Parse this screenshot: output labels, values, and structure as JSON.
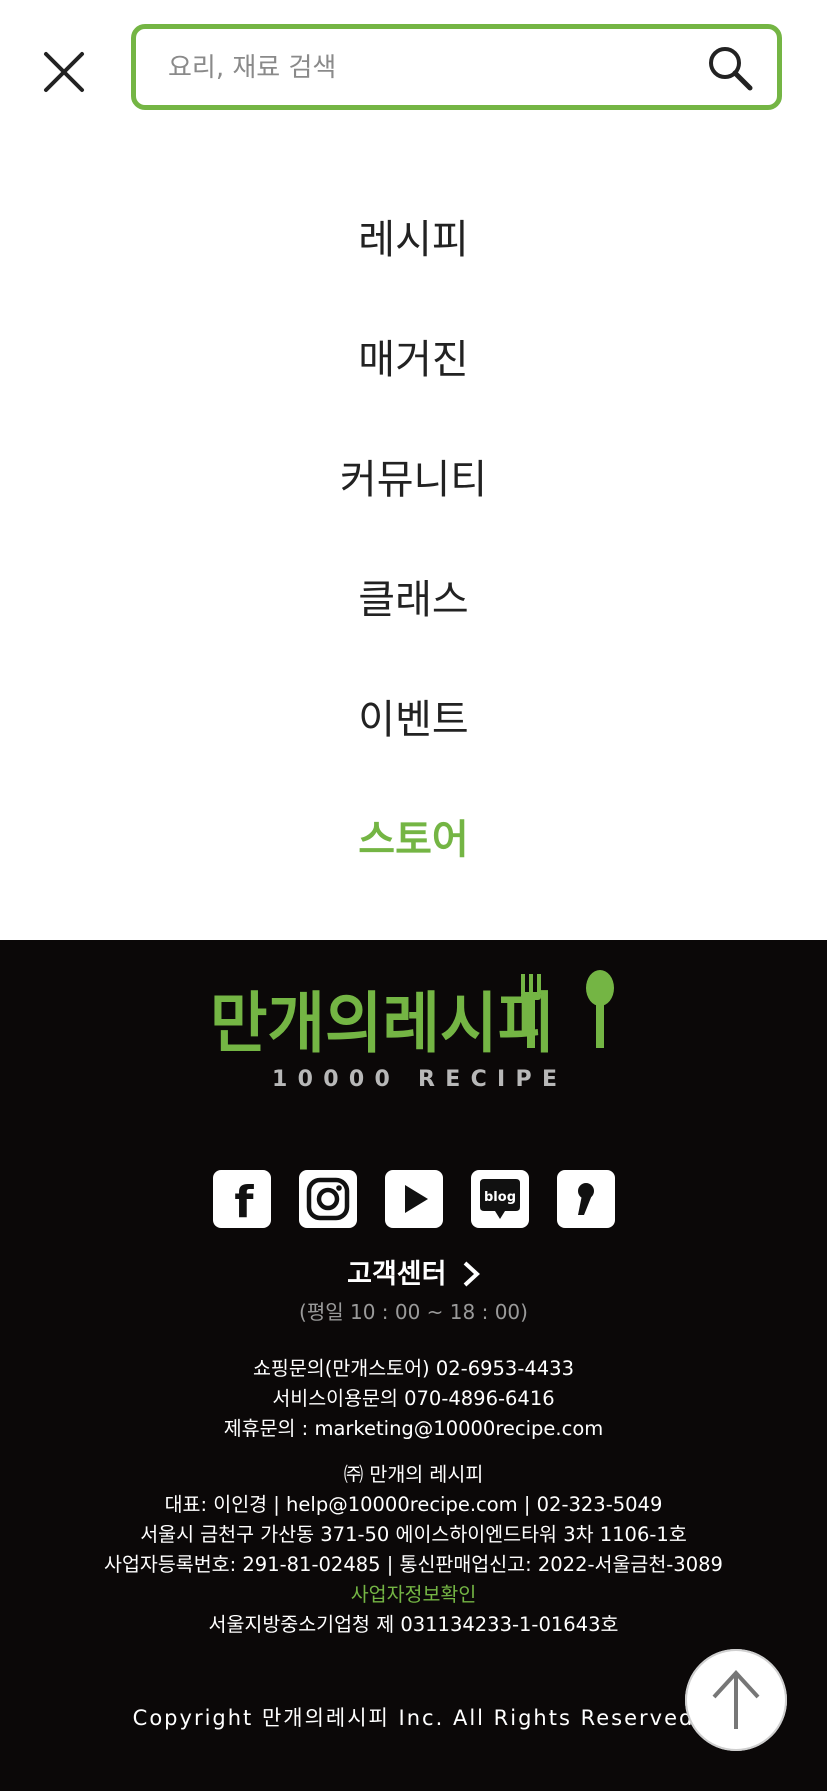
{
  "search": {
    "placeholder": "요리, 재료 검색",
    "value": ""
  },
  "menu": {
    "items": [
      {
        "label": "레시피"
      },
      {
        "label": "매거진"
      },
      {
        "label": "커뮤니티"
      },
      {
        "label": "클래스"
      },
      {
        "label": "이벤트"
      },
      {
        "label": "스토어"
      }
    ],
    "active_index": 5
  },
  "footer": {
    "logo": {
      "name": "만개의레시피",
      "subtitle": "10000 RECIPE"
    },
    "social": [
      {
        "name": "facebook-icon",
        "label": "f"
      },
      {
        "name": "instagram-icon"
      },
      {
        "name": "youtube-icon"
      },
      {
        "name": "blog-icon",
        "label": "blog"
      },
      {
        "name": "kakaostory-icon"
      }
    ],
    "customer_center": {
      "title": "고객센터",
      "hours": "(평일 10 : 00 ~ 18 : 00)"
    },
    "contacts": {
      "shopping": "쇼핑문의(만개스토어) 02-6953-4433",
      "service": "서비스이용문의 070-4896-6416",
      "partnership": "제휴문의 : marketing@10000recipe.com"
    },
    "company": {
      "name": "㈜ 만개의 레시피",
      "ceo_line": "대표: 이인경 | help@10000recipe.com | 02-323-5049",
      "address": "서울시 금천구 가산동 371-50 에이스하이엔드타워 3차 1106-1호",
      "registration": "사업자등록번호: 291-81-02485 | 통신판매업신고: 2022-서울금천-3089",
      "biz_info_link": "사업자정보확인",
      "sme": "서울지방중소기업청 제 031134233-1-01643호"
    },
    "copyright": "Copyright 만개의레시피 Inc. All Rights Reserved"
  },
  "colors": {
    "accent": "#74b544",
    "footer_bg": "#0b0808",
    "text": "#222222"
  }
}
